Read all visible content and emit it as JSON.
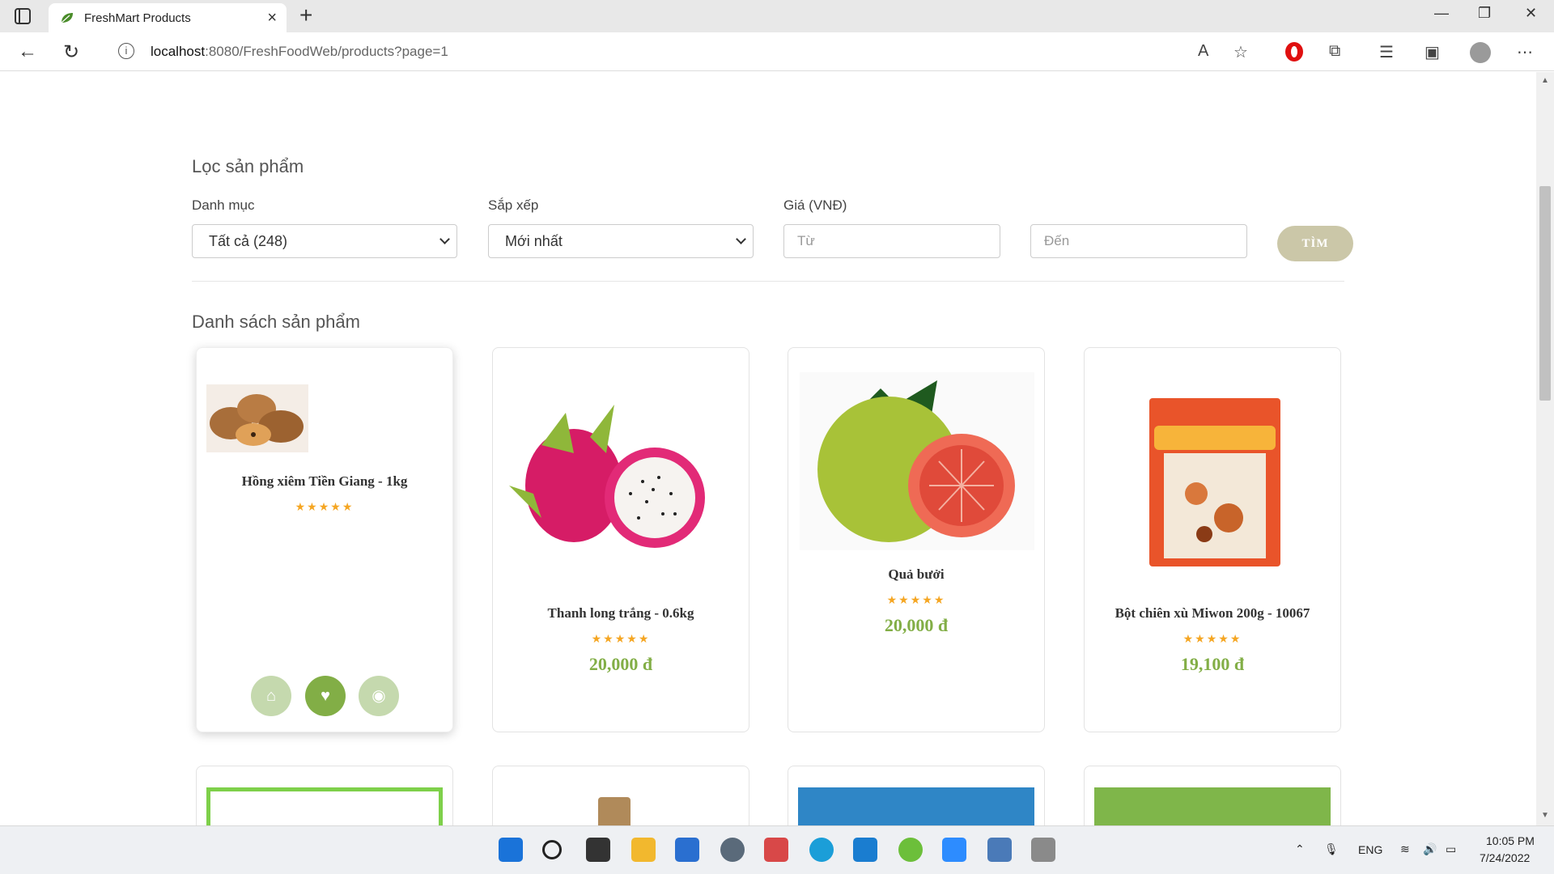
{
  "browser": {
    "tab_title": "FreshMart Products",
    "url_host": "localhost",
    "url_path": ":8080/FreshFoodWeb/products?page=1"
  },
  "filter": {
    "title": "Lọc sản phẩm",
    "category_label": "Danh mục",
    "category_value": "Tất cả (248)",
    "sort_label": "Sắp xếp",
    "sort_value": "Mới nhất",
    "price_label": "Giá (VNĐ)",
    "price_from_placeholder": "Từ",
    "price_to_placeholder": "Đến",
    "search_button": "TÌM"
  },
  "products_section": {
    "title": "Danh sách sản phẩm",
    "items": [
      {
        "name": "Hồng xiêm Tiền Giang - 1kg",
        "stars": "★★★★★",
        "price": ""
      },
      {
        "name": "Thanh long trắng - 0.6kg",
        "stars": "★★★★★",
        "price": "20,000 đ"
      },
      {
        "name": "Quả bưởi",
        "stars": "★★★★★",
        "price": "20,000 đ"
      },
      {
        "name": "Bột chiên xù Miwon 200g - 10067",
        "stars": "★★★★★",
        "price": "19,100 đ"
      }
    ],
    "card_actions": [
      "basket-icon",
      "heart-icon",
      "eye-icon"
    ],
    "accent_color": "#82ae46"
  },
  "taskbar": {
    "lang": "ENG",
    "time": "10:05 PM",
    "date": "7/24/2022"
  }
}
